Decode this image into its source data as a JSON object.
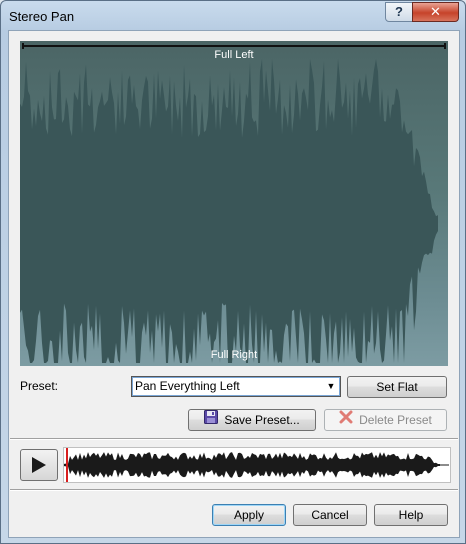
{
  "window": {
    "title": "Stereo Pan",
    "help_glyph": "?",
    "close_glyph": "✕"
  },
  "pan_display": {
    "top_label": "Full Left",
    "bottom_label": "Full Right",
    "background_color": "#587878",
    "wave_color": "#3a5658"
  },
  "preset": {
    "label": "Preset:",
    "selected": "Pan Everything Left",
    "arrow_glyph": "▼"
  },
  "buttons": {
    "set_flat": "Set Flat",
    "save_preset": "Save Preset...",
    "delete_preset": "Delete Preset",
    "apply": "Apply",
    "cancel": "Cancel",
    "help": "Help"
  },
  "icons": {
    "save": "floppy-disk-icon",
    "delete": "red-x-icon",
    "play": "play-icon"
  },
  "colors": {
    "playhead": "#d81e1e",
    "mini_wave": "#1a1a1a"
  }
}
